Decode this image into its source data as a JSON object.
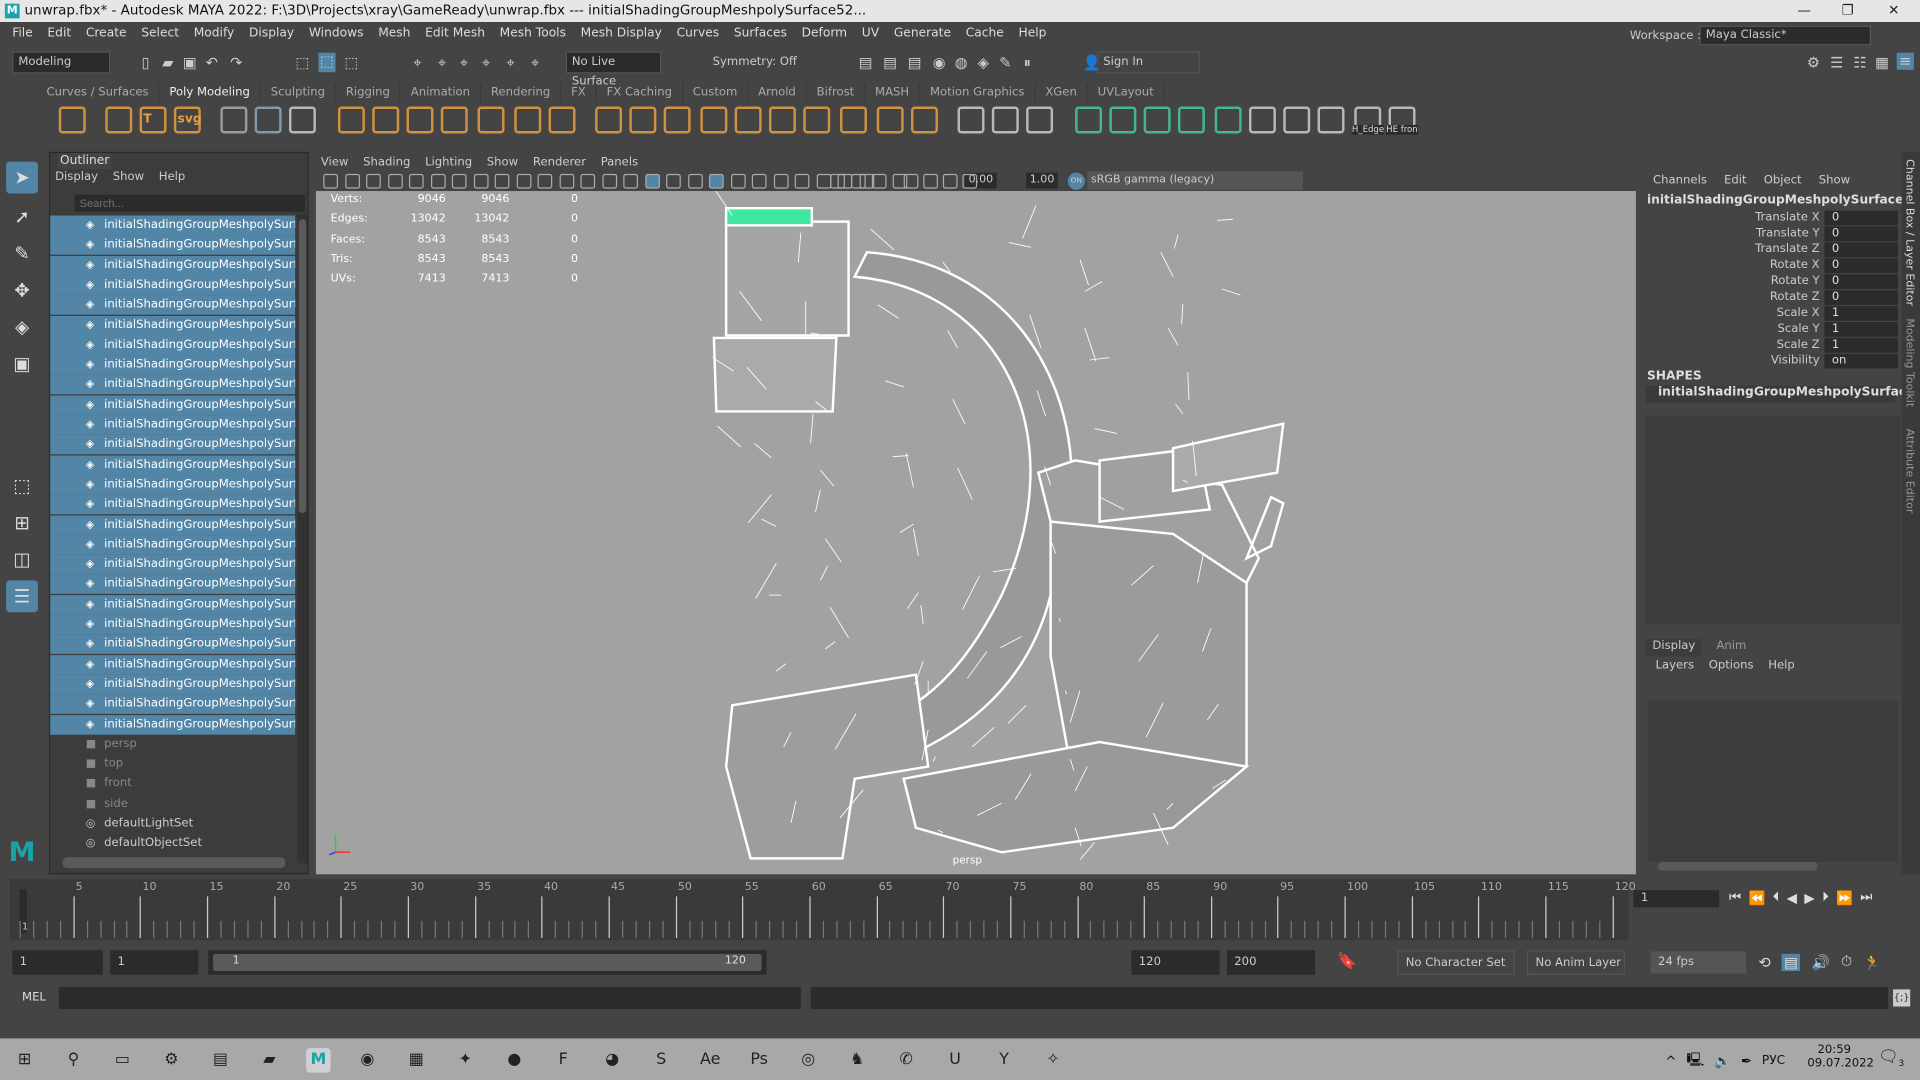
{
  "title": {
    "text": "unwrap.fbx* - Autodesk MAYA 2022: F:\\3D\\Projects\\xray\\GameReady\\unwrap.fbx   ---   initialShadingGroupMeshpolySurface52...",
    "logo": "M",
    "min": "—",
    "max": "❐",
    "close": "✕"
  },
  "menus": [
    "File",
    "Edit",
    "Create",
    "Select",
    "Modify",
    "Display",
    "Windows",
    "Mesh",
    "Edit Mesh",
    "Mesh Tools",
    "Mesh Display",
    "Curves",
    "Surfaces",
    "Deform",
    "UV",
    "Generate",
    "Cache",
    "Help"
  ],
  "status": {
    "mode": "Modeling",
    "live_surface": "No Live Surface",
    "symmetry": "Symmetry: Off",
    "sign_in": "Sign In",
    "workspace_label": "Workspace :",
    "workspace": "Maya Classic*"
  },
  "shelf": {
    "tabs": [
      "Curves / Surfaces",
      "Poly Modeling",
      "Sculpting",
      "Rigging",
      "Animation",
      "Rendering",
      "FX",
      "FX Caching",
      "Custom",
      "Arnold",
      "Bifrost",
      "MASH",
      "Motion Graphics",
      "XGen",
      "UVLayout"
    ],
    "active": "Poly Modeling",
    "labels": [
      "T",
      "svg",
      "H_Edge",
      "HE fron"
    ]
  },
  "outliner": {
    "title": "Outliner",
    "menus": [
      "Display",
      "Show",
      "Help"
    ],
    "search_placeholder": "Search...",
    "selected_item": "initialShadingGroupMeshpolySurface",
    "selected_count": 26,
    "items": [
      "persp",
      "top",
      "front",
      "side",
      "defaultLightSet",
      "defaultObjectSet"
    ]
  },
  "viewport": {
    "menus": [
      "View",
      "Shading",
      "Lighting",
      "Show",
      "Renderer",
      "Panels"
    ],
    "exposure": "0.00",
    "gamma": "1.00",
    "color_space": "sRGB gamma (legacy)",
    "camera": "persp",
    "stats": [
      {
        "label": "Verts:",
        "a": "9046",
        "b": "9046",
        "c": "0"
      },
      {
        "label": "Edges:",
        "a": "13042",
        "b": "13042",
        "c": "0"
      },
      {
        "label": "Faces:",
        "a": "8543",
        "b": "8543",
        "c": "0"
      },
      {
        "label": "Tris:",
        "a": "8543",
        "b": "8543",
        "c": "0"
      },
      {
        "label": "UVs:",
        "a": "7413",
        "b": "7413",
        "c": "0"
      }
    ]
  },
  "channelbox": {
    "menus": [
      "Channels",
      "Edit",
      "Object",
      "Show"
    ],
    "object": "initialShadingGroupMeshpolySurface5...",
    "channels": [
      {
        "label": "Translate X",
        "value": "0"
      },
      {
        "label": "Translate Y",
        "value": "0"
      },
      {
        "label": "Translate Z",
        "value": "0"
      },
      {
        "label": "Rotate X",
        "value": "0"
      },
      {
        "label": "Rotate Y",
        "value": "0"
      },
      {
        "label": "Rotate Z",
        "value": "0"
      },
      {
        "label": "Scale X",
        "value": "1"
      },
      {
        "label": "Scale Y",
        "value": "1"
      },
      {
        "label": "Scale Z",
        "value": "1"
      },
      {
        "label": "Visibility",
        "value": "on"
      }
    ],
    "shapes_label": "SHAPES",
    "shape": "initialShadingGroupMeshpolySurfac..."
  },
  "side_tabs": [
    "Channel Box / Layer Editor",
    "Modeling Toolkit",
    "Attribute Editor"
  ],
  "layer_editor": {
    "tabs": [
      "Display",
      "Anim"
    ],
    "menus": [
      "Layers",
      "Options",
      "Help"
    ]
  },
  "timeline": {
    "ticks": [
      5,
      10,
      15,
      20,
      25,
      30,
      35,
      40,
      45,
      50,
      55,
      60,
      65,
      70,
      75,
      80,
      85,
      90,
      95,
      100,
      105,
      110,
      115,
      120
    ],
    "current_frame": "1",
    "frame_field": "1"
  },
  "range": {
    "start": "1",
    "playback_start": "1",
    "slider_start": "1",
    "slider_end": "120",
    "playback_end": "120",
    "end": "200",
    "character_set": "No Character Set",
    "anim_layer": "No Anim Layer",
    "fps": "24 fps"
  },
  "command": {
    "label": "MEL"
  },
  "taskbar": {
    "lang": "РУС",
    "time": "20:59",
    "date": "09.07.2022",
    "notifications": "3"
  },
  "colors": {
    "selection": "#5285a6",
    "viewport_bg": "#a2a2a2",
    "wire": "#ffffff",
    "highlight": "#3fe8a0"
  }
}
